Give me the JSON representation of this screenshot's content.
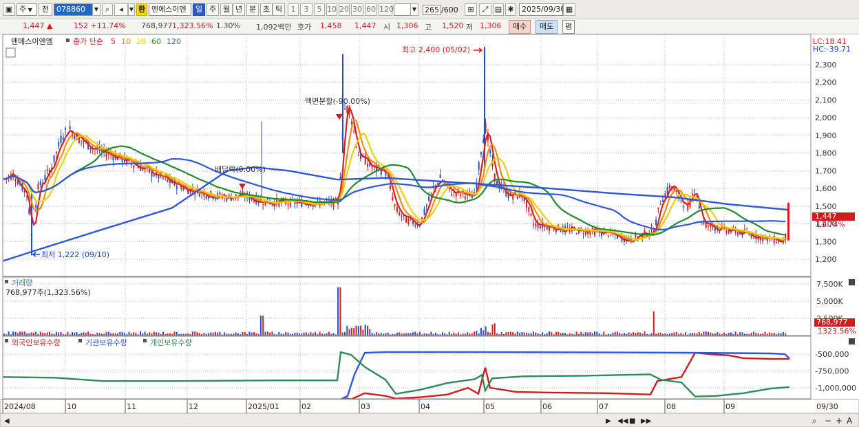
{
  "toolbar": {
    "type_select": "주",
    "prev_label": "전",
    "code": "078860",
    "hw_label": "환",
    "stock_name": "엔에스이엔",
    "period_buttons": [
      "일",
      "주",
      "월",
      "년",
      "분",
      "초",
      "틱"
    ],
    "selected_period": "일",
    "interval_buttons": [
      "1",
      "3",
      "5",
      "10",
      "20",
      "30",
      "60",
      "120"
    ],
    "count": "265",
    "count_total": "/600",
    "date": "2025/09/30"
  },
  "quote": {
    "price": "1,447 ▲",
    "change": "152 +11.74%",
    "volume": "768,977",
    "volume_ratio": "1,323.56%",
    "turnover_pct": "1.30%",
    "amount": "1,092백만",
    "ask_label": "호가",
    "ask": "1,458",
    "bid": "1,447",
    "open_label": "시",
    "open": "1,306",
    "high_label": "고",
    "high": "1,520",
    "low_label": "저",
    "low": "1,306",
    "buy_label": "매수",
    "sell_label": "매도",
    "avg_label": "평"
  },
  "price_panel": {
    "stock": "엔에스이엔엠",
    "ma_title": "종가 단순",
    "ma_periods": [
      {
        "label": "5",
        "color": "#d61f1f"
      },
      {
        "label": "10",
        "color": "#f08a16"
      },
      {
        "label": "20",
        "color": "#e8d300"
      },
      {
        "label": "60",
        "color": "#1f8a2c"
      },
      {
        "label": "120",
        "color": "#2d57d8"
      }
    ],
    "lc": "LC:18.41",
    "hc": "HC:-39.71",
    "last_price": "1,447",
    "last_pct": "11.74%",
    "high_annot": "최고 2,400 (05/02)",
    "low_annot": "최저 1,222 (09/10)",
    "split_annot": "액면분할(-90.00%)",
    "dividend_annot": "배당락(0.00%)",
    "y_ticks": [
      "2,300",
      "2,200",
      "2,100",
      "2,000",
      "1,900",
      "1,800",
      "1,700",
      "1,600",
      "1,500",
      "1,400",
      "1,300",
      "1,200"
    ]
  },
  "volume_panel": {
    "title": "거래량",
    "value": "768,977주(1,323.56%)",
    "y_ticks": [
      "7,500K",
      "5,000K",
      "2,500K"
    ],
    "last_value": "768,977",
    "last_pct": "1323.56%"
  },
  "holdings_panel": {
    "legend": [
      {
        "label": "외국인보유수량",
        "color": "#d11b1b"
      },
      {
        "label": "기관보유수량",
        "color": "#2d57d8"
      },
      {
        "label": "개인보유수량",
        "color": "#2e8b57"
      }
    ],
    "y_ticks": [
      "-500,000",
      "-750,000",
      "-1,000,000"
    ]
  },
  "x_axis": {
    "labels": [
      "2024/08",
      "10",
      "11",
      "12",
      "2025/01",
      "02",
      "03",
      "04",
      "05",
      "06",
      "07",
      "08",
      "09"
    ],
    "right_label": "09/30"
  },
  "colors": {
    "up": "#d61f1f",
    "down": "#1f4fd1",
    "grid": "#b7b7b7"
  }
}
